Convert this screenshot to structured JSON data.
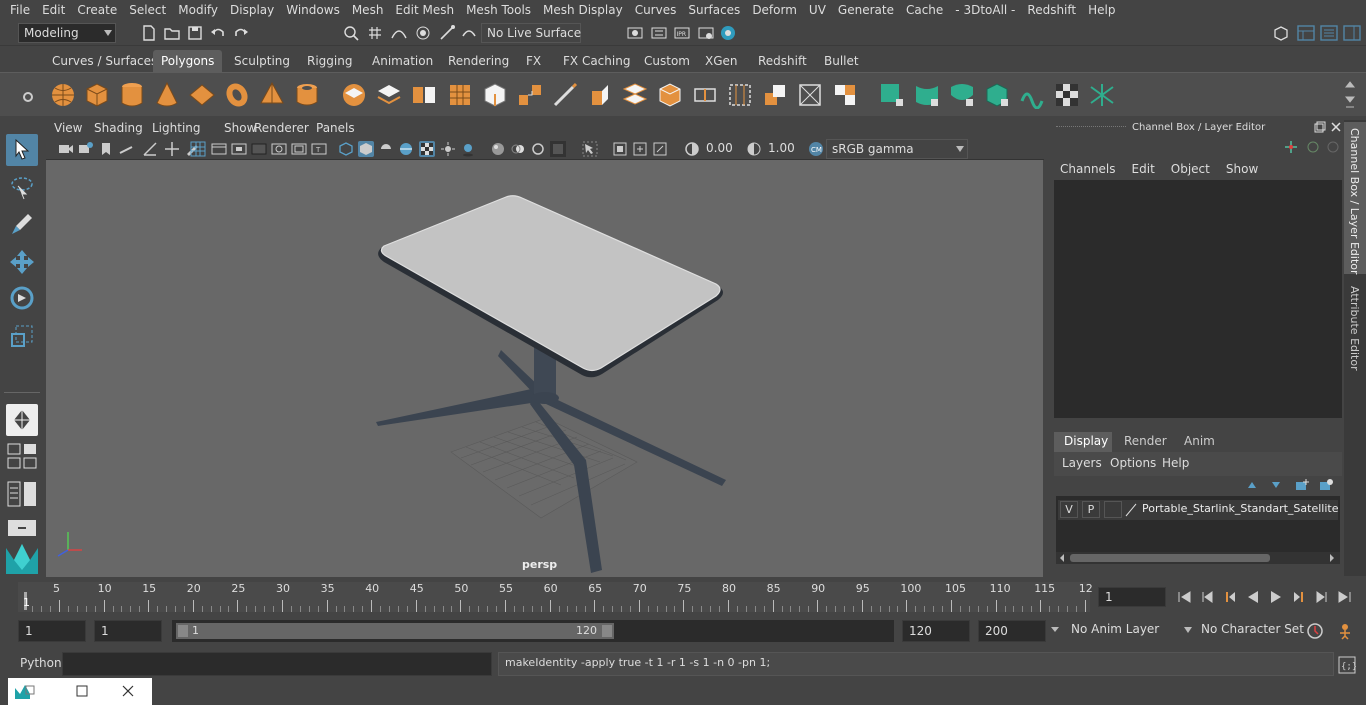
{
  "menubar": [
    "File",
    "Edit",
    "Create",
    "Select",
    "Modify",
    "Display",
    "Windows",
    "Mesh",
    "Edit Mesh",
    "Mesh Tools",
    "Mesh Display",
    "Curves",
    "Surfaces",
    "Deform",
    "UV",
    "Generate",
    "Cache",
    "- 3DtoAll -",
    "Redshift",
    "Help"
  ],
  "status": {
    "mode": "Modeling",
    "live_surface": "No Live Surface"
  },
  "shelf_tabs": [
    "Curves / Surfaces",
    "Polygons",
    "Sculpting",
    "Rigging",
    "Animation",
    "Rendering",
    "FX",
    "FX Caching",
    "Custom",
    "XGen",
    "Redshift",
    "Bullet"
  ],
  "shelf_active": "Polygons",
  "viewport": {
    "menu": [
      "View",
      "Shading",
      "Lighting",
      "Show",
      "Renderer",
      "Panels"
    ],
    "exposure": "0.00",
    "gamma": "1.00",
    "colorspace": "sRGB gamma",
    "camera": "persp"
  },
  "channel_box": {
    "title": "Channel Box / Layer Editor",
    "menu": [
      "Channels",
      "Edit",
      "Object",
      "Show"
    ],
    "tabs": [
      "Display",
      "Render",
      "Anim"
    ],
    "active_tab": "Display",
    "layer_menu": [
      "Layers",
      "Options",
      "Help"
    ],
    "layer": {
      "v": "V",
      "p": "P",
      "name": "Portable_Starlink_Standart_Satellite_D"
    }
  },
  "side_tabs": [
    "Channel Box / Layer Editor",
    "Attribute Editor"
  ],
  "timeline": {
    "ticks": [
      "5",
      "10",
      "15",
      "20",
      "25",
      "30",
      "35",
      "40",
      "45",
      "50",
      "55",
      "60",
      "65",
      "70",
      "75",
      "80",
      "85",
      "90",
      "95",
      "100",
      "105",
      "110",
      "115",
      "12"
    ],
    "start_label": "1",
    "current": "1"
  },
  "range": {
    "start": "1",
    "playback_start": "1",
    "slider_start": "1",
    "slider_end": "120",
    "playback_end": "120",
    "end": "200",
    "anim_layer": "No Anim Layer",
    "char_set": "No Character Set"
  },
  "cmdline": {
    "lang": "Python",
    "output": "makeIdentity -apply true -t 1 -r 1 -s 1 -n 0 -pn 1;"
  },
  "colors": {
    "accent": "#5285a6",
    "orange": "#e3913f",
    "teal": "#2fae8e",
    "bg": "#444444",
    "viewport": "#686868"
  }
}
